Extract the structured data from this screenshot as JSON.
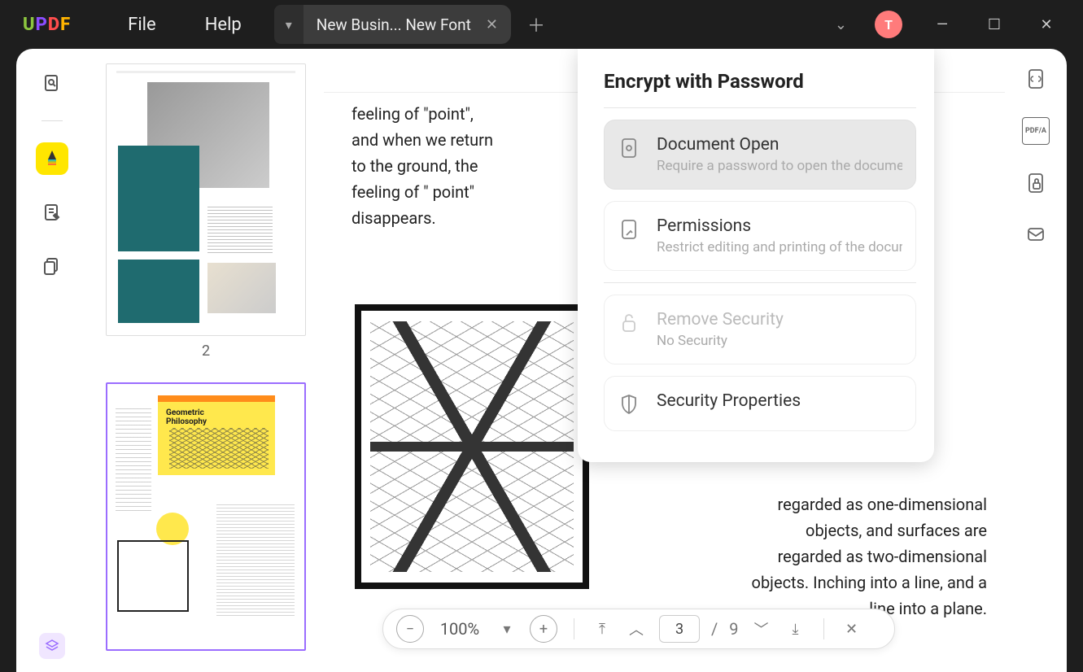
{
  "logo": {
    "u": "U",
    "p": "P",
    "d": "D",
    "f": "F"
  },
  "menu": {
    "file": "File",
    "help": "Help"
  },
  "tab": {
    "title": "New Busin... New Font"
  },
  "avatar": {
    "initial": "T"
  },
  "thumbs": {
    "page2_num": "2",
    "page3_title1": "Geometric",
    "page3_title2": "Philosophy"
  },
  "doc": {
    "text1": "feeling of \"point\", and when we return to the ground, the feeling of \" point\" disappears.",
    "text2": "regarded as one-dimensional objects, and surfaces are regarded as two-dimensional objects. Inching into a line, and a line into a plane."
  },
  "nav": {
    "zoom": "100%",
    "page": "3",
    "total": "9",
    "sep": "/"
  },
  "panel": {
    "title": "Encrypt with Password",
    "docopen": {
      "title": "Document Open",
      "sub": "Require a password to open the document"
    },
    "perm": {
      "title": "Permissions",
      "sub": "Restrict editing and printing of the document"
    },
    "remove": {
      "title": "Remove Security",
      "sub": "No Security"
    },
    "props": {
      "title": "Security Properties"
    }
  },
  "rtoolbar": {
    "pdfa": "PDF/A"
  }
}
